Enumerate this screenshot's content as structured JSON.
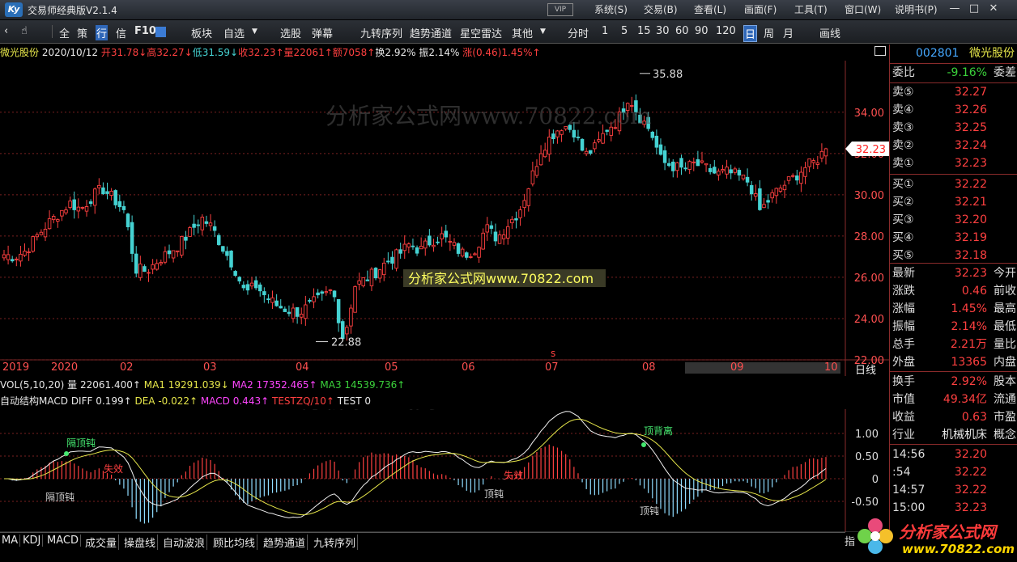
{
  "window": {
    "title": "交易师经典版V2.1.4",
    "logo": "Ky",
    "vip": "VIP",
    "menu": [
      "系统(S)",
      "交易(B)",
      "查看(L)",
      "画面(F)",
      "工具(T)",
      "窗口(W)",
      "说明书(P)"
    ],
    "controls": [
      "—",
      "□",
      "✕"
    ]
  },
  "toolbar": {
    "items": [
      "全",
      "策",
      "行",
      "信",
      "F10",
      "板块",
      "自选",
      "选股",
      "弹幕",
      "九转序列",
      "趋势通道",
      "星空雷达",
      "其他",
      "分时",
      "1",
      "5",
      "15",
      "30",
      "60",
      "90",
      "120",
      "日",
      "周",
      "月",
      "画线"
    ],
    "active": [
      "行",
      "日"
    ]
  },
  "header": {
    "name": "微光股份",
    "date": "2020/10/12",
    "open": "开31.78↓",
    "high": "高32.27↓",
    "low": "低31.59↓",
    "close": "收32.23↑",
    "vol": "量22061↑",
    "amount": "额7058↑",
    "turnover": "换2.92%",
    "amplitude": "振2.14%",
    "change": "涨(0.46)1.45%↑"
  },
  "chart_data": {
    "type": "candlestick",
    "title": "",
    "ylim": [
      22.0,
      36.5
    ],
    "y_ticks": [
      "34.00",
      "32.00",
      "30.00",
      "28.00",
      "26.00",
      "24.00",
      "22.00"
    ],
    "x_ticks": [
      "2019",
      "2020",
      "02",
      "03",
      "04",
      "05",
      "06",
      "07",
      "08",
      "09",
      "10"
    ],
    "period_label": "日线",
    "annotations": {
      "max": "35.88",
      "min": "22.88",
      "last": "32.23",
      "mark": "s"
    },
    "watermark": "分析家公式网www.70822.com",
    "watermark_top": "分析家公式网www.70822.com",
    "watermark_mid": "分析家公式网www.70822.com",
    "close_path": [
      27.1,
      27.0,
      27.3,
      28.0,
      28.6,
      29.1,
      29.6,
      29.3,
      29.9,
      30.3,
      29.8,
      29.2,
      26.4,
      26.3,
      26.8,
      27.2,
      27.6,
      28.2,
      28.9,
      28.4,
      27.4,
      26.5,
      25.2,
      25.6,
      25.0,
      24.6,
      24.4,
      24.3,
      24.7,
      25.0,
      25.4,
      22.9,
      25.6,
      25.9,
      26.3,
      26.8,
      27.1,
      27.6,
      27.3,
      27.8,
      28.0,
      27.5,
      27.1,
      27.4,
      28.4,
      27.9,
      28.6,
      29.2,
      30.6,
      32.2,
      32.9,
      33.4,
      33.1,
      31.9,
      32.3,
      33.2,
      33.6,
      34.8,
      33.8,
      33.1,
      31.6,
      31.4,
      31.2,
      31.5,
      31.3,
      31.0,
      31.1,
      30.9,
      30.6,
      29.2,
      29.9,
      30.4,
      30.8,
      31.3,
      31.6,
      32.23
    ],
    "macd_mini": {
      "indicator": "自动结构MACD",
      "diff": "0.199↑",
      "dea": "-0.022↑",
      "macd": "0.443↑",
      "testzq": "TESTZQ/10↑",
      "test": "TEST 0",
      "y_ticks": [
        "1.00",
        "0.50",
        "0",
        "-0.50"
      ],
      "labels": [
        "隔顶钝",
        "隔顶钝",
        "失效",
        "失效",
        "顶钝",
        "顶钝",
        "顶背离"
      ]
    },
    "volume": {
      "indicator": "VOL(5,10,20)",
      "vol": "22061.400↑",
      "ma1": "19291.039↓",
      "ma2": "17352.465↑",
      "ma3": "14539.736↑"
    }
  },
  "quote": {
    "code": "002801",
    "name": "微光股份",
    "weibi_label": "委比",
    "weibi": "-9.16%",
    "weicha_label": "委差",
    "asks": [
      {
        "label": "卖⑤",
        "price": "32.27"
      },
      {
        "label": "卖④",
        "price": "32.26"
      },
      {
        "label": "卖③",
        "price": "32.25"
      },
      {
        "label": "卖②",
        "price": "32.24"
      },
      {
        "label": "卖①",
        "price": "32.23"
      }
    ],
    "bids": [
      {
        "label": "买①",
        "price": "32.22"
      },
      {
        "label": "买②",
        "price": "32.21"
      },
      {
        "label": "买③",
        "price": "32.20"
      },
      {
        "label": "买④",
        "price": "32.19"
      },
      {
        "label": "买⑤",
        "price": "32.18"
      }
    ],
    "stats": [
      {
        "label": "最新",
        "value": "32.23",
        "right": "今开"
      },
      {
        "label": "涨跌",
        "value": "0.46",
        "right": "前收"
      },
      {
        "label": "涨幅",
        "value": "1.45%",
        "right": "最高"
      },
      {
        "label": "振幅",
        "value": "2.14%",
        "right": "最低"
      },
      {
        "label": "总手",
        "value": "2.21万",
        "right": "量比"
      },
      {
        "label": "外盘",
        "value": "13365",
        "right": "内盘"
      }
    ],
    "stats2": [
      {
        "label": "换手",
        "value": "2.92%",
        "right": "股本"
      },
      {
        "label": "市值",
        "value": "49.34亿",
        "right": "流通"
      },
      {
        "label": "收益",
        "value": "0.63",
        "right": "市盈"
      },
      {
        "label": "行业",
        "value": "机械机床",
        "right": "概念"
      }
    ],
    "ticks": [
      {
        "time": "14:56",
        "price": "32.20"
      },
      {
        "time": ":54",
        "price": "32.22"
      },
      {
        "time": "14:57",
        "price": "32.22"
      },
      {
        "time": "15:00",
        "price": "32.23"
      }
    ]
  },
  "bottom_tabs": [
    "MA",
    "KDJ",
    "MACD",
    "成交量",
    "操盘线",
    "自动波浪",
    "顾比均线",
    "趋势通道",
    "九转序列"
  ],
  "bottom_right": "指",
  "logo_text": {
    "line1": "分析家公式网",
    "line2": "www.70822.com"
  },
  "colors": {
    "up": "#ff4040",
    "down": "#45d2d2",
    "grid": "#8a2b2b",
    "accent": "#2f67b8"
  }
}
